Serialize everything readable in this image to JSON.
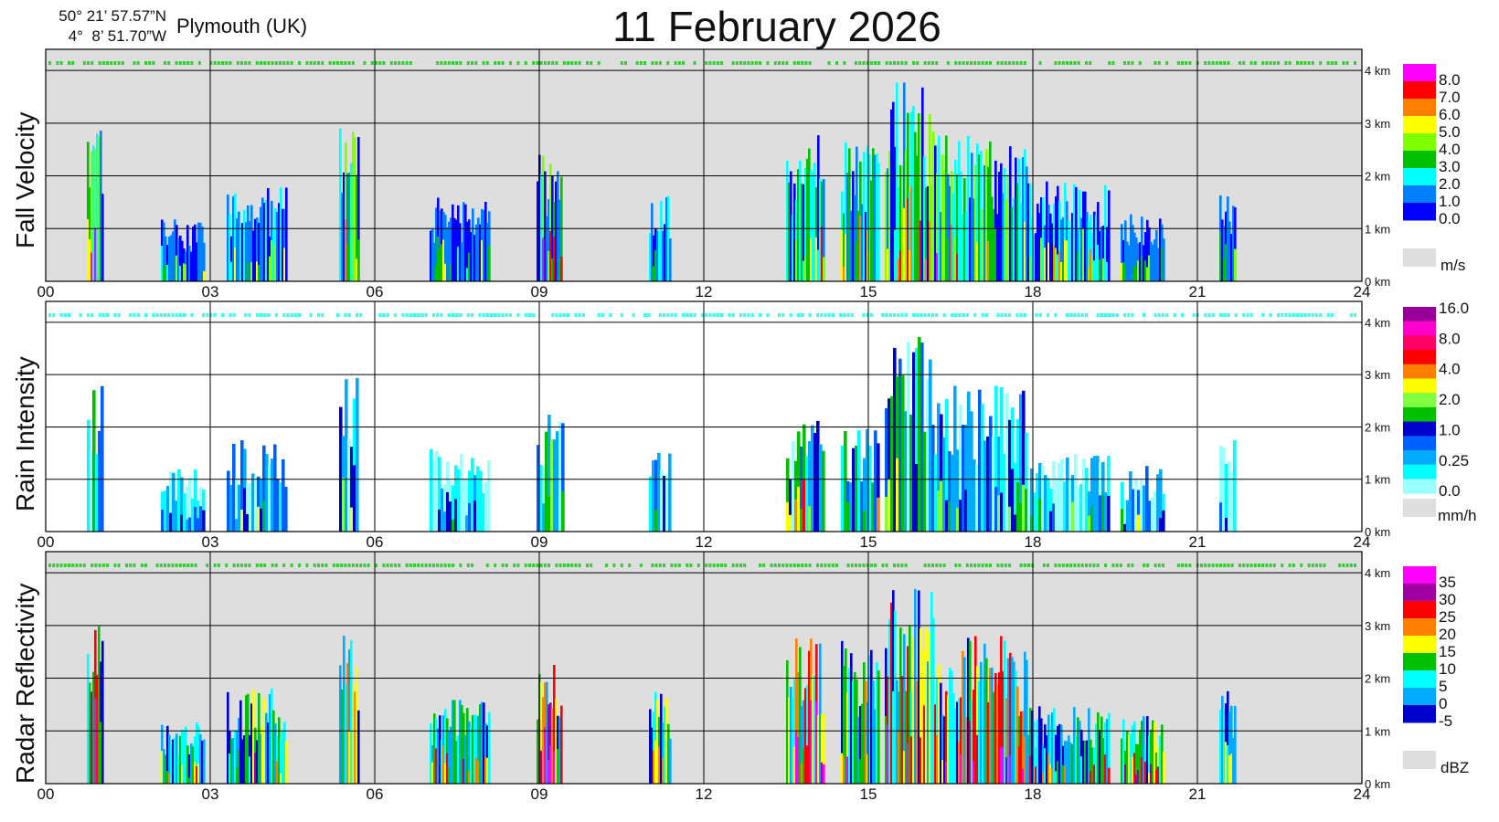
{
  "header": {
    "lat": "50° 21’ 57.57”N",
    "lon": "4°  8’ 51.70”W",
    "site": "Plymouth (UK)",
    "title": "11 February  2026"
  },
  "colors": {
    "background": "#dedede",
    "grid": "#000000",
    "detection_line_a": "#33cc33",
    "detection_line_b": "#33ffee"
  },
  "chart_data": [
    {
      "type": "heatmap",
      "panel": "fall_velocity",
      "ylabel": "Fall Velocity",
      "unit": "m/s",
      "x_ticks": [
        "00",
        "03",
        "06",
        "09",
        "12",
        "15",
        "18",
        "21",
        "24"
      ],
      "xlim": [
        0,
        24
      ],
      "y_ticks": [
        "0 km",
        "1 km",
        "2 km",
        "3 km",
        "4 km"
      ],
      "ylim": [
        0,
        4.4
      ],
      "grid": true,
      "background": "#dedede",
      "colorbar": {
        "labels": [
          "8.0",
          "7.0",
          "6.0",
          "5.0",
          "4.0",
          "3.0",
          "2.0",
          "1.0",
          "0.0"
        ],
        "colors": [
          "#ff00ff",
          "#ff0000",
          "#ff7f00",
          "#ffff00",
          "#7fff00",
          "#00c000",
          "#00ffff",
          "#0080ff",
          "#0000ff"
        ]
      },
      "events": [
        {
          "start": 0.75,
          "end": 1.05,
          "top": 3.1,
          "level": 5
        },
        {
          "start": 2.1,
          "end": 2.9,
          "top": 1.2,
          "level": 1
        },
        {
          "start": 3.3,
          "end": 4.4,
          "top": 1.8,
          "level": 2
        },
        {
          "start": 5.35,
          "end": 5.7,
          "top": 3.0,
          "level": 4
        },
        {
          "start": 7.0,
          "end": 8.1,
          "top": 1.6,
          "level": 1
        },
        {
          "start": 8.95,
          "end": 9.4,
          "top": 2.5,
          "level": 4
        },
        {
          "start": 11.0,
          "end": 11.4,
          "top": 1.8,
          "level": 2
        },
        {
          "start": 13.5,
          "end": 14.2,
          "top": 2.8,
          "level": 3
        },
        {
          "start": 14.5,
          "end": 15.2,
          "top": 2.8,
          "level": 3
        },
        {
          "start": 15.3,
          "end": 16.2,
          "top": 3.8,
          "level": 4
        },
        {
          "start": 16.2,
          "end": 17.9,
          "top": 2.8,
          "level": 4
        },
        {
          "start": 17.9,
          "end": 19.4,
          "top": 1.9,
          "level": 2
        },
        {
          "start": 19.6,
          "end": 20.4,
          "top": 1.3,
          "level": 1
        },
        {
          "start": 21.4,
          "end": 21.7,
          "top": 1.8,
          "level": 1
        }
      ]
    },
    {
      "type": "heatmap",
      "panel": "rain_intensity",
      "ylabel": "Rain Intensity",
      "unit": "mm/h",
      "x_ticks": [
        "00",
        "03",
        "06",
        "09",
        "12",
        "15",
        "18",
        "21",
        "24"
      ],
      "xlim": [
        0,
        24
      ],
      "y_ticks": [
        "0 km",
        "1 km",
        "2 km",
        "3 km",
        "4 km"
      ],
      "ylim": [
        0,
        4.4
      ],
      "grid": true,
      "background": "#ffffff",
      "colorbar": {
        "labels": [
          "16.0",
          "8.0",
          "4.0",
          "2.0",
          "1.0",
          "0.25",
          "0.0"
        ],
        "colors": [
          "#990099",
          "#ff00cc",
          "#ff0066",
          "#ff0000",
          "#ff8000",
          "#ffff00",
          "#80ff40",
          "#00c000",
          "#0000cc",
          "#0060ff",
          "#00aaff",
          "#00ffff",
          "#99ffff"
        ]
      },
      "events": [
        {
          "start": 0.75,
          "end": 1.05,
          "top": 3.1,
          "level": 6
        },
        {
          "start": 2.1,
          "end": 2.9,
          "top": 1.2,
          "level": 1
        },
        {
          "start": 3.3,
          "end": 4.4,
          "top": 1.8,
          "level": 2
        },
        {
          "start": 5.35,
          "end": 5.7,
          "top": 3.0,
          "level": 4
        },
        {
          "start": 7.0,
          "end": 8.1,
          "top": 1.6,
          "level": 1
        },
        {
          "start": 8.95,
          "end": 9.4,
          "top": 2.5,
          "level": 5
        },
        {
          "start": 11.0,
          "end": 11.4,
          "top": 1.8,
          "level": 3
        },
        {
          "start": 13.5,
          "end": 14.2,
          "top": 2.2,
          "level": 4
        },
        {
          "start": 14.5,
          "end": 15.2,
          "top": 2.0,
          "level": 4
        },
        {
          "start": 15.3,
          "end": 16.2,
          "top": 3.8,
          "level": 4
        },
        {
          "start": 16.2,
          "end": 17.9,
          "top": 2.8,
          "level": 3
        },
        {
          "start": 17.9,
          "end": 19.4,
          "top": 1.5,
          "level": 1
        },
        {
          "start": 19.6,
          "end": 20.4,
          "top": 1.3,
          "level": 2
        },
        {
          "start": 21.4,
          "end": 21.7,
          "top": 1.8,
          "level": 0
        }
      ]
    },
    {
      "type": "heatmap",
      "panel": "radar_reflectivity",
      "ylabel": "Radar Reflectivity",
      "unit": "dBZ",
      "x_ticks": [
        "00",
        "03",
        "06",
        "09",
        "12",
        "15",
        "18",
        "21",
        "24"
      ],
      "xlim": [
        0,
        24
      ],
      "y_ticks": [
        "0 km",
        "1 km",
        "2 km",
        "3 km",
        "4 km"
      ],
      "ylim": [
        0,
        4.4
      ],
      "grid": true,
      "background": "#dedede",
      "colorbar": {
        "labels": [
          "35",
          "30",
          "25",
          "20",
          "15",
          "10",
          "5",
          "0",
          "-5"
        ],
        "colors": [
          "#ff00ff",
          "#a000a0",
          "#ff0000",
          "#ff8000",
          "#ffff00",
          "#00c000",
          "#00ffff",
          "#00aaff",
          "#0000cc"
        ]
      },
      "events": [
        {
          "start": 0.75,
          "end": 1.05,
          "top": 3.1,
          "level": 6
        },
        {
          "start": 2.1,
          "end": 2.9,
          "top": 1.2,
          "level": 2
        },
        {
          "start": 3.3,
          "end": 4.4,
          "top": 1.8,
          "level": 3
        },
        {
          "start": 5.35,
          "end": 5.7,
          "top": 3.0,
          "level": 4
        },
        {
          "start": 7.0,
          "end": 8.1,
          "top": 1.6,
          "level": 2
        },
        {
          "start": 8.95,
          "end": 9.4,
          "top": 2.5,
          "level": 6
        },
        {
          "start": 11.0,
          "end": 11.4,
          "top": 1.8,
          "level": 4
        },
        {
          "start": 13.5,
          "end": 14.2,
          "top": 2.8,
          "level": 5
        },
        {
          "start": 14.5,
          "end": 15.2,
          "top": 2.8,
          "level": 4
        },
        {
          "start": 15.3,
          "end": 16.2,
          "top": 3.8,
          "level": 5
        },
        {
          "start": 16.2,
          "end": 17.9,
          "top": 2.8,
          "level": 5
        },
        {
          "start": 17.9,
          "end": 19.4,
          "top": 1.5,
          "level": 2
        },
        {
          "start": 19.6,
          "end": 20.4,
          "top": 1.3,
          "level": 3
        },
        {
          "start": 21.4,
          "end": 21.7,
          "top": 1.8,
          "level": 1
        }
      ]
    }
  ]
}
